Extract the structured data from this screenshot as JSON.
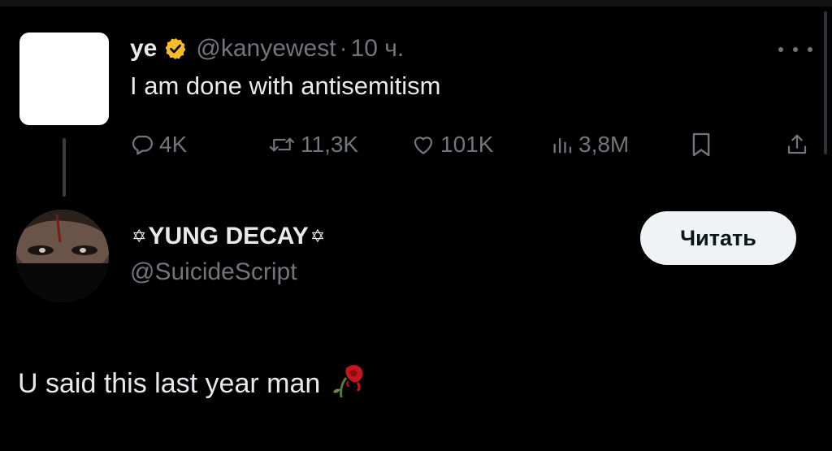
{
  "quoted_tweet": {
    "display_name": "ye",
    "handle": "@kanyewest",
    "separator": "·",
    "time": "10 ч.",
    "text": "I am done with antisemitism",
    "stats": {
      "replies": "4K",
      "retweets": "11,3K",
      "likes": "101K",
      "views": "3,8M"
    },
    "verified_badge_color": "#f4bd28"
  },
  "author": {
    "display_name": "YUNG DECAY",
    "name_decoration": "✡",
    "handle": "@SuicideScript",
    "follow_label": "Читать"
  },
  "reply": {
    "text": "U said this last year man",
    "emoji_icon": "wilted-rose-icon"
  },
  "colors": {
    "background": "#000000",
    "primary_text": "#e7e9ea",
    "secondary_text": "#71767b",
    "button_bg": "#eff3f4"
  }
}
